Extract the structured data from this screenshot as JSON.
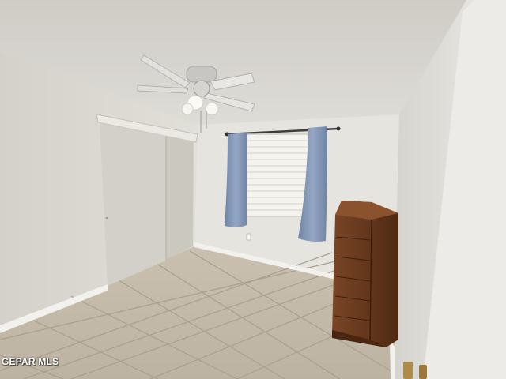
{
  "photo": {
    "watermark_text": "GEPAR MLS",
    "colors": {
      "ceiling": "#d9d7d2",
      "left_wall": "#dcd9d2",
      "back_wall": "#e6e4df",
      "right_wall": "#e3e1dd",
      "floor_tile": "#c8bfb0",
      "grout": "#a99f90",
      "curtain": "#7f93b3",
      "dresser": "#6a3a1c",
      "closet_door": "#d2cfc8",
      "window_blind": "#f4f3ee"
    }
  }
}
